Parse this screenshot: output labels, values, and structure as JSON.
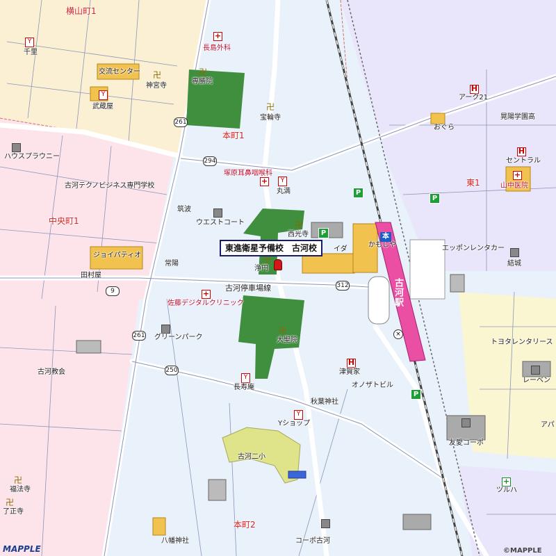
{
  "map": {
    "callout": "東進衛星予備校　古河校",
    "copyright": "©MAPPLE",
    "logo": "MAPPLE",
    "station": {
      "name": "古河駅",
      "badge": "本"
    },
    "route_shields": [
      "261",
      "294",
      "9",
      "312",
      "261",
      "250"
    ],
    "labels": [
      "横山町1",
      "千里",
      "交流センター",
      "神宮寺",
      "武蔵屋",
      "長島外科",
      "専勝院",
      "宝輪寺",
      "ハウスプラウニー",
      "塚原耳鼻咽喉科",
      "丸満",
      "古河テクノビジネス専門学校",
      "筑波",
      "ウエストコート",
      "西光寺",
      "イダ",
      "かもじや",
      "中央町1",
      "ジョイパティオ",
      "常陽",
      "浄円",
      "田村屋",
      "古河停車場線",
      "佐藤デジタルクリニック",
      "大聖院",
      "グリーンパーク",
      "古河教会",
      "長寿庵",
      "津賀家",
      "オノザトビル",
      "秋葉神社",
      "Yショップ",
      "古河二小",
      "福法寺",
      "了正寺",
      "八幡神社",
      "本町2",
      "コーポ古河",
      "本町1",
      "アーク21",
      "晃陽学園高",
      "おぐら",
      "セントラル",
      "東1",
      "山中医院",
      "エッポンレンタカー",
      "結城",
      "トヨタレンタリース",
      "レーベン",
      "友愛コーポ",
      "ツルハ",
      "アパ"
    ]
  }
}
